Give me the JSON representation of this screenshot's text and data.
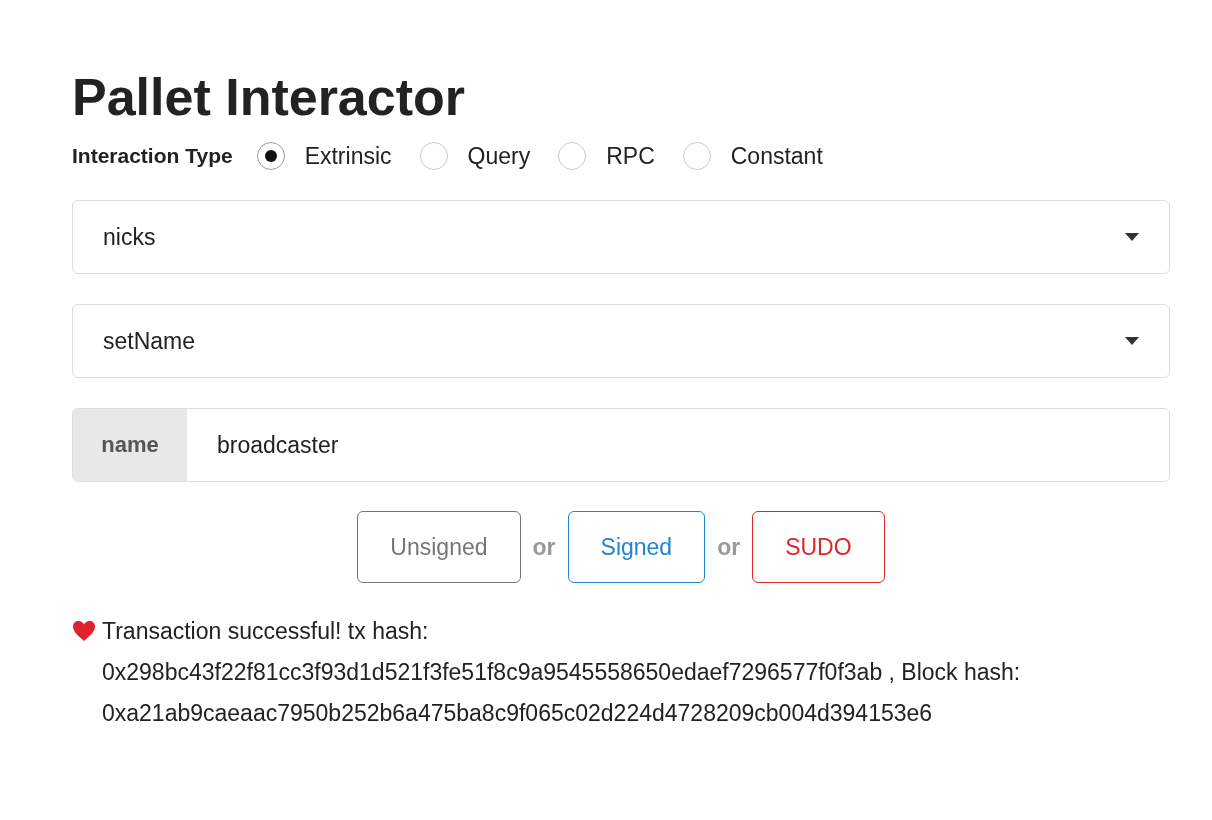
{
  "title": "Pallet Interactor",
  "interaction_type": {
    "label": "Interaction Type",
    "options": [
      {
        "label": "Extrinsic",
        "selected": true
      },
      {
        "label": "Query",
        "selected": false
      },
      {
        "label": "RPC",
        "selected": false
      },
      {
        "label": "Constant",
        "selected": false
      }
    ]
  },
  "dropdowns": [
    {
      "value": "nicks"
    },
    {
      "value": "setName"
    }
  ],
  "param": {
    "label": "name",
    "value": "broadcaster"
  },
  "buttons": [
    {
      "label": "Unsigned",
      "color": "#767676"
    },
    {
      "label": "Signed",
      "color": "#2185d0"
    },
    {
      "label": "SUDO",
      "color": "#db2828"
    }
  ],
  "separators": [
    "or",
    "or"
  ],
  "status": "Transaction successful! tx hash: 0x298bc43f22f81cc3f93d1d521f3fe51f8c9a9545558650edaef7296577f0f3ab , Block hash: 0xa21ab9caeaac7950b252b6a475ba8c9f065c02d224d4728209cb004d394153e6"
}
